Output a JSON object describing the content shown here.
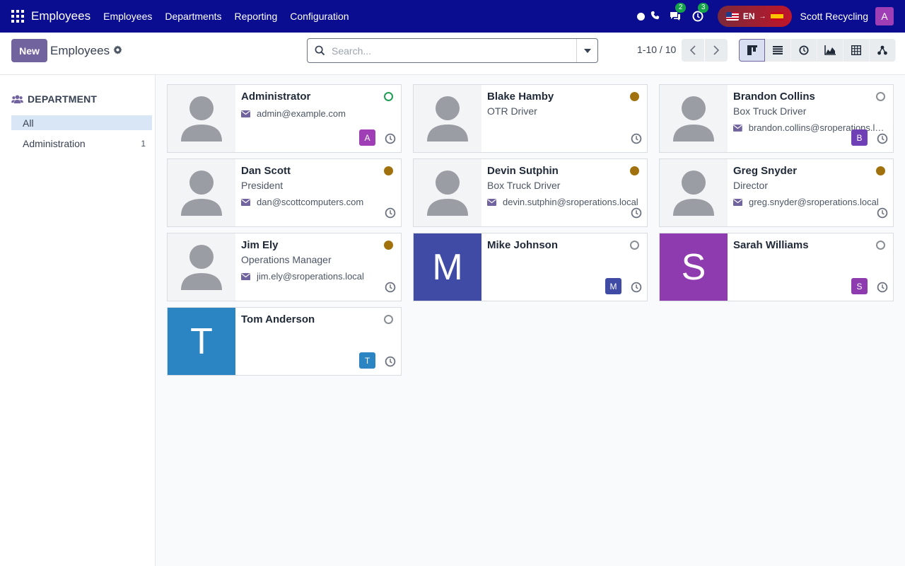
{
  "navbar": {
    "app_title": "Employees",
    "menu": [
      "Employees",
      "Departments",
      "Reporting",
      "Configuration"
    ],
    "messages_count": "2",
    "activities_count": "3",
    "lang_code": "EN",
    "company": "Scott Recycling",
    "user_initial": "A"
  },
  "control": {
    "new_label": "New",
    "breadcrumb": "Employees",
    "search_placeholder": "Search...",
    "pager": "1-10 / 10"
  },
  "sidebar": {
    "heading": "DEPARTMENT",
    "items": [
      {
        "label": "All",
        "count": ""
      },
      {
        "label": "Administration",
        "count": "1"
      }
    ]
  },
  "employees": [
    {
      "name": "Administrator",
      "job": "",
      "email": "admin@example.com",
      "presence": "online",
      "avatar": "A",
      "avatar_color": "#a03fb5",
      "photo": "silhouette"
    },
    {
      "name": "Blake Hamby",
      "job": "OTR Driver",
      "email": "",
      "presence": "away",
      "avatar": "",
      "photo": "silhouette"
    },
    {
      "name": "Brandon Collins",
      "job": "Box Truck Driver",
      "email": "brandon.collins@sroperations.local",
      "presence": "offline",
      "avatar": "B",
      "avatar_color": "#6f3fb5",
      "photo": "silhouette"
    },
    {
      "name": "Dan Scott",
      "job": "President",
      "email": "dan@scottcomputers.com",
      "presence": "away",
      "avatar": "",
      "photo": "silhouette"
    },
    {
      "name": "Devin Sutphin",
      "job": "Box Truck Driver",
      "email": "devin.sutphin@sroperations.local",
      "presence": "away",
      "avatar": "",
      "photo": "silhouette"
    },
    {
      "name": "Greg Snyder",
      "job": "Director",
      "email": "greg.snyder@sroperations.local",
      "presence": "away",
      "avatar": "",
      "photo": "silhouette"
    },
    {
      "name": "Jim Ely",
      "job": "Operations Manager",
      "email": "jim.ely@sroperations.local",
      "presence": "away",
      "avatar": "",
      "photo": "silhouette"
    },
    {
      "name": "Mike Johnson",
      "job": "",
      "email": "",
      "presence": "offline",
      "avatar": "M",
      "avatar_color": "#3f4ba5",
      "photo": "letter",
      "photo_letter": "M",
      "photo_color": "#3f4ba5"
    },
    {
      "name": "Sarah Williams",
      "job": "",
      "email": "",
      "presence": "offline",
      "avatar": "S",
      "avatar_color": "#8e3bb0",
      "photo": "letter",
      "photo_letter": "S",
      "photo_color": "#8e3bb0"
    },
    {
      "name": "Tom Anderson",
      "job": "",
      "email": "",
      "presence": "offline",
      "avatar": "T",
      "avatar_color": "#2b85c2",
      "photo": "letter",
      "photo_letter": "T",
      "photo_color": "#2b85c2"
    }
  ],
  "colors": {
    "navbar": "#0a0d8f",
    "primary": "#71639e",
    "presence_online": "#1f9d55",
    "presence_away": "#a1710d"
  },
  "icons": {
    "apps": "apps-grid-icon",
    "search": "magnifier-icon",
    "settings": "gear-icon",
    "email": "envelope-icon",
    "activity": "clock-icon"
  }
}
